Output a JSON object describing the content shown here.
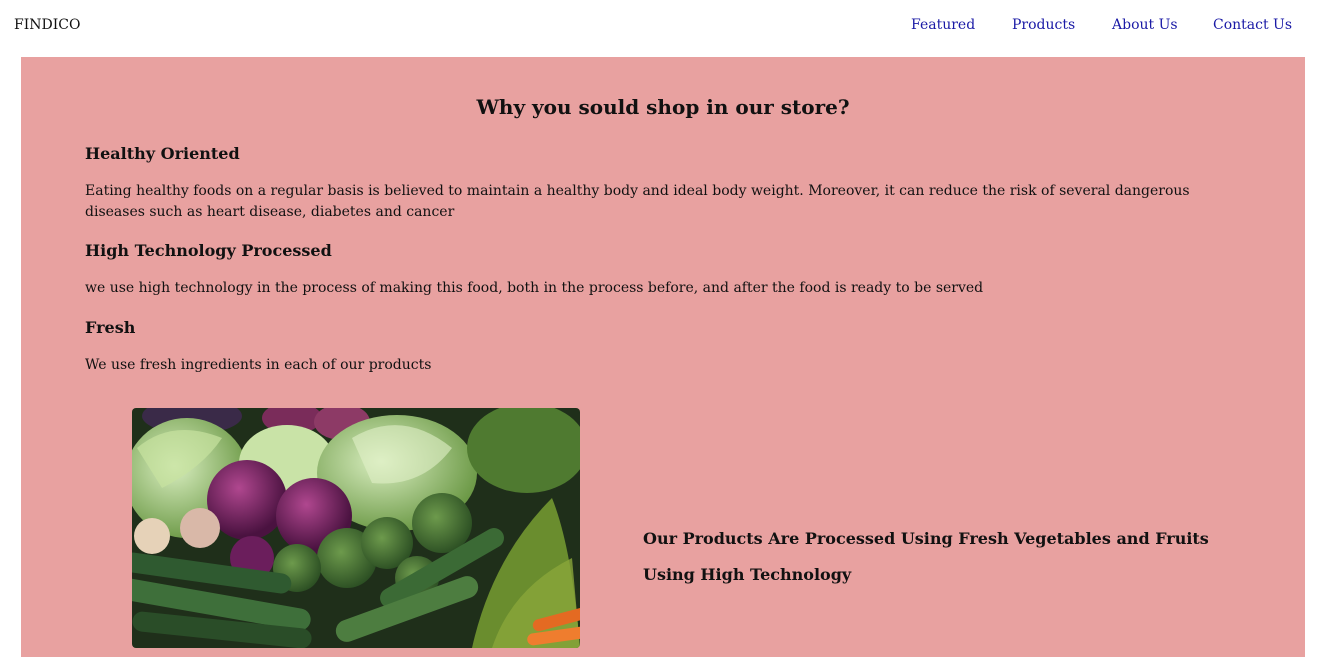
{
  "nav": {
    "brand": "FINDICO",
    "links": [
      "Featured",
      "Products",
      "About Us",
      "Contact Us"
    ]
  },
  "section": {
    "title": "Why you sould shop in our store?",
    "features": [
      {
        "heading": "Healthy Oriented",
        "text": "Eating healthy foods on a regular basis is believed to maintain a healthy body and ideal body weight. Moreover, it can reduce the risk of several dangerous diseases such as heart disease, diabetes and cancer"
      },
      {
        "heading": "High Technology Processed",
        "text": "we use high technology in the process of making this food, both in the process before, and after the food is ready to be served"
      },
      {
        "heading": "Fresh",
        "text": "We use fresh ingredients in each of our products"
      }
    ],
    "promo": [
      "Our Products Are Processed Using Fresh Vegetables and Fruits",
      "Using High Technology"
    ]
  },
  "colors": {
    "panel_bg": "#e8a1a0",
    "nav_link": "#1a1aa6"
  }
}
